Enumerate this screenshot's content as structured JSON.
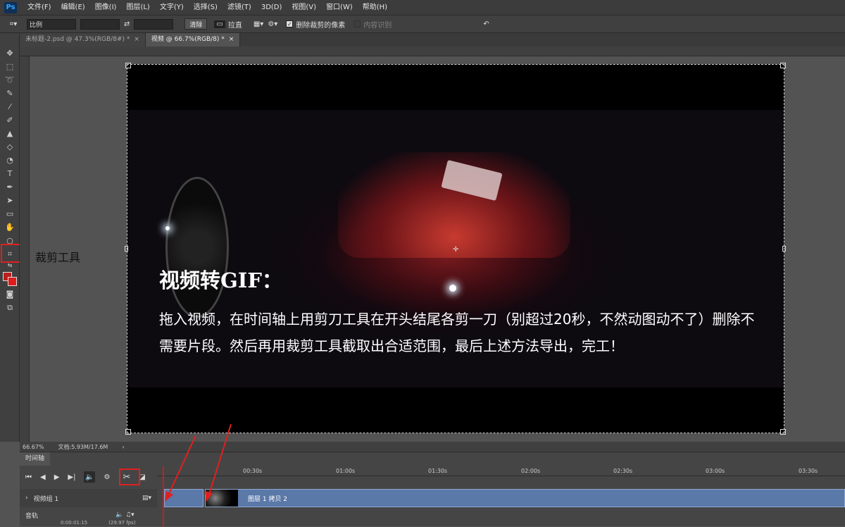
{
  "app": {
    "logo": "Ps"
  },
  "menu": [
    "文件(F)",
    "编辑(E)",
    "图像(I)",
    "图层(L)",
    "文字(Y)",
    "选择(S)",
    "滤镜(T)",
    "3D(D)",
    "视图(V)",
    "窗口(W)",
    "帮助(H)"
  ],
  "options": {
    "ratio_select": "比例",
    "clear_button": "清除",
    "straighten_label": "拉直",
    "delete_cropped_label": "删除裁剪的像素",
    "content_aware_label": "内容识别"
  },
  "tabs": [
    {
      "label": "未标题-2.psd @ 47.3%(RGB/8#) *"
    },
    {
      "label": "视频 @ 66.7%(RGB/8) *"
    }
  ],
  "annotation": {
    "crop_tool_label": "裁剪工具"
  },
  "canvas": {
    "title": "视频转GIF：",
    "body": "拖入视频，在时间轴上用剪刀工具在开头结尾各剪一刀（别超过20秒，不然动图动不了）删除不需要片段。然后再用裁剪工具截取出合适范围，最后上述方法导出，完工！"
  },
  "status": {
    "zoom": "66.67%",
    "doc_info": "文档:5.93M/17.6M"
  },
  "timeline": {
    "tab": "时间轴",
    "ticks": [
      "00:30s",
      "01:00s",
      "01:30s",
      "02:00s",
      "02:30s",
      "03:00s",
      "03:30s"
    ],
    "video_group": "视频组 1",
    "clip_label": "图层 1 拷贝 2",
    "audio_track": "音轨",
    "timecode": "0:00:01:15",
    "fps": "(29.97 fps)"
  },
  "colors": {
    "highlight": "#e02020",
    "clip": "#5a78a8",
    "fg_color": "#b8201e"
  }
}
